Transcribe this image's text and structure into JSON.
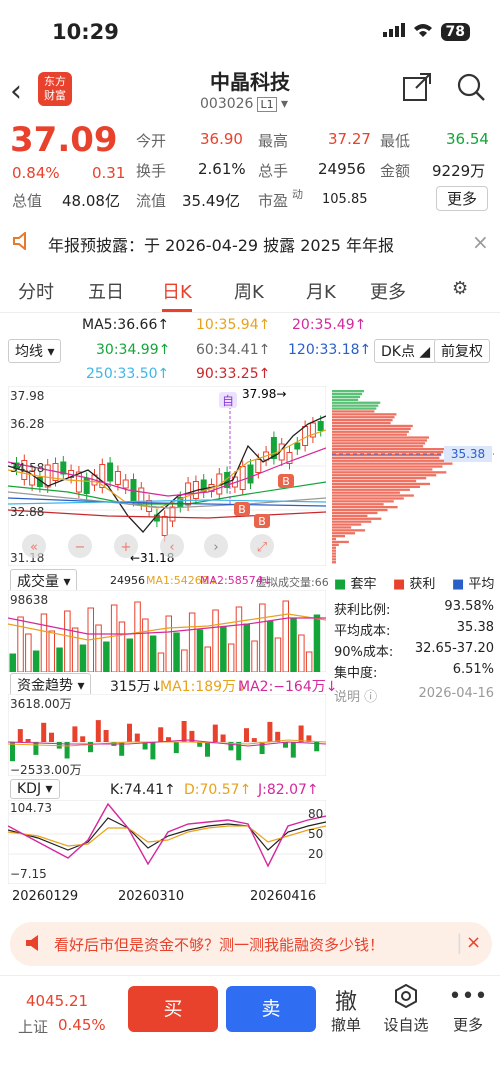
{
  "status": {
    "time": "10:29",
    "battery": "78"
  },
  "header": {
    "logo_line1": "东方",
    "logo_line2": "财富",
    "title": "中晶科技",
    "code": "003026",
    "badge": "L1"
  },
  "quote": {
    "price": "37.09",
    "pct": "0.84%",
    "change": "0.31",
    "open_label": "今开",
    "open": "36.90",
    "high_label": "最高",
    "high": "37.27",
    "low_label": "最低",
    "low": "36.54",
    "turnover_label": "换手",
    "turnover": "2.61%",
    "volume_label": "总手",
    "volume": "24956",
    "amount_label": "金额",
    "amount": "9229万",
    "mktcap_label": "总值",
    "mktcap": "48.08亿",
    "float_label": "流值",
    "float": "35.49亿",
    "pe_label": "市盈",
    "pe_sup": "动",
    "pe": "105.85",
    "more": "更多"
  },
  "banner": {
    "text": "年报预披露：于 2026-04-29 披露 2025 年年报"
  },
  "tabs": [
    "分时",
    "五日",
    "日K",
    "周K",
    "月K",
    "更多",
    "⚙"
  ],
  "ma": {
    "label": "均线",
    "ma5": "MA5:36.66↑",
    "ma10": "10:35.94↑",
    "ma20": "20:35.49↑",
    "ma30": "30:34.99↑",
    "ma60": "60:34.41↑",
    "ma120": "120:33.18↑",
    "ma250": "250:33.50↑",
    "ma90": "90:33.25↑",
    "dk": "DK点",
    "fq": "前复权"
  },
  "kline": {
    "y_top": "37.98",
    "y2": "36.28",
    "y3": "34.58",
    "y4": "32.88",
    "y_bottom": "31.18",
    "hi_marker": "37.98→",
    "lo_marker": "←31.18",
    "zi": "自",
    "buy": "B"
  },
  "chip": {
    "avg": "35.38",
    "legend_a": "套牢",
    "legend_b": "获利",
    "legend_c": "平均",
    "ratio_label": "获利比例:",
    "ratio": "93.58%",
    "avgcost_label": "平均成本:",
    "avgcost": "35.38",
    "cost90_label": "90%成本:",
    "cost90": "32.65-37.20",
    "conc_label": "集中度:",
    "conc": "6.51%",
    "note_label": "说明",
    "note_date": "2026-04-16"
  },
  "volume": {
    "label": "成交量",
    "v": "24956",
    "ma1": "MA1:54268↓",
    "ma2": "MA2:58574↓",
    "virtual": "虚拟成交量:66",
    "ymax": "98638"
  },
  "fund": {
    "label": "资金趋势",
    "v": "315万↓",
    "ma1": "MA1:189万↓",
    "ma2": "MA2:−164万↓",
    "ymax": "3618.00万",
    "ymin": "−2533.00万"
  },
  "kdj": {
    "label": "KDJ",
    "k": "K:74.41↑",
    "d": "D:70.57↑",
    "j": "J:82.07↑",
    "ymax": "104.73",
    "ymin": "−7.15",
    "l80": "80",
    "l50": "50",
    "l20": "20"
  },
  "dates": [
    "20260129",
    "20260310",
    "20260416"
  ],
  "ad": {
    "text": "看好后市但是资金不够？测一测我能融资多少钱！"
  },
  "bottom": {
    "index_value": "4045.21",
    "index_name": "上证",
    "index_pct": "0.45%",
    "buy": "买",
    "sell": "卖",
    "t1": "撤单",
    "t2": "设自选",
    "t3": "更多",
    "g1": "撤"
  },
  "chart_data": {
    "type": "candlestick",
    "ylim": [
      31.18,
      37.98
    ],
    "y_ticks": [
      37.98,
      36.28,
      34.58,
      32.88,
      31.18
    ],
    "x_labels": [
      "20260129",
      "20260310",
      "20260416"
    ],
    "high": 37.98,
    "low": 31.18,
    "last": 37.09,
    "chip_average": 35.38,
    "colors": {
      "up": "#e8412c",
      "down": "#14a53a"
    }
  }
}
